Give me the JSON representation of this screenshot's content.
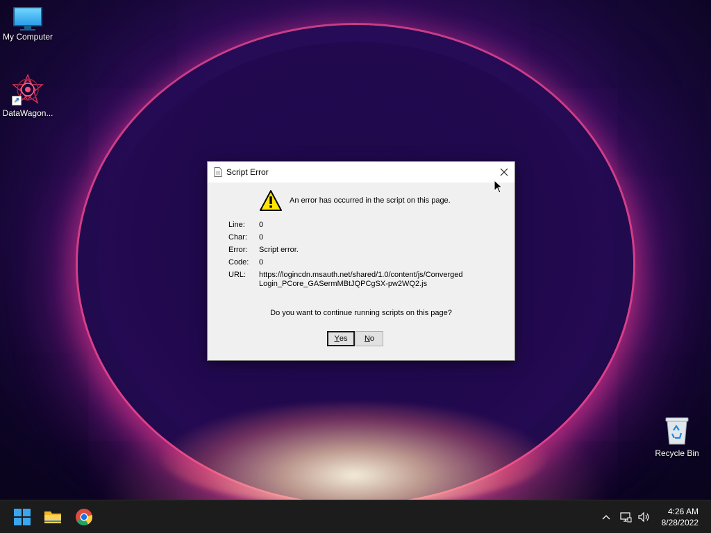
{
  "desktop": {
    "icons": [
      {
        "label": "My Computer",
        "icon": "monitor-icon"
      },
      {
        "label": "DataWagon...",
        "icon": "datawagon-app-icon"
      },
      {
        "label": "Recycle Bin",
        "icon": "recycle-bin-icon"
      }
    ]
  },
  "dialog": {
    "title": "Script Error",
    "close_icon": "close-icon",
    "message": "An error has occurred in the script on this page.",
    "details": [
      {
        "key": "Line:",
        "value": "0"
      },
      {
        "key": "Char:",
        "value": "0"
      },
      {
        "key": "Error:",
        "value": "Script error."
      },
      {
        "key": "Code:",
        "value": "0"
      },
      {
        "key": "URL:",
        "value": "https://logincdn.msauth.net/shared/1.0/content/js/ConvergedLogin_PCore_GASermMBtJQPCgSX-pw2WQ2.js"
      }
    ],
    "question": "Do you want to continue running scripts on this page?",
    "yes_button": {
      "accel": "Y",
      "rest": "es"
    },
    "no_button": {
      "accel": "N",
      "rest": "o"
    }
  },
  "taskbar": {
    "items": [
      "windows-start-icon",
      "file-explorer-icon",
      "chrome-icon"
    ],
    "tray_icons": [
      "chevron-up-icon",
      "network-icon",
      "volume-icon"
    ],
    "time": "4:26 AM",
    "date": "8/28/2022"
  },
  "colors": {
    "dialog_bg": "#f0f0f0",
    "taskbar_bg": "#1c1c1c",
    "warning_yellow": "#ffe500"
  }
}
